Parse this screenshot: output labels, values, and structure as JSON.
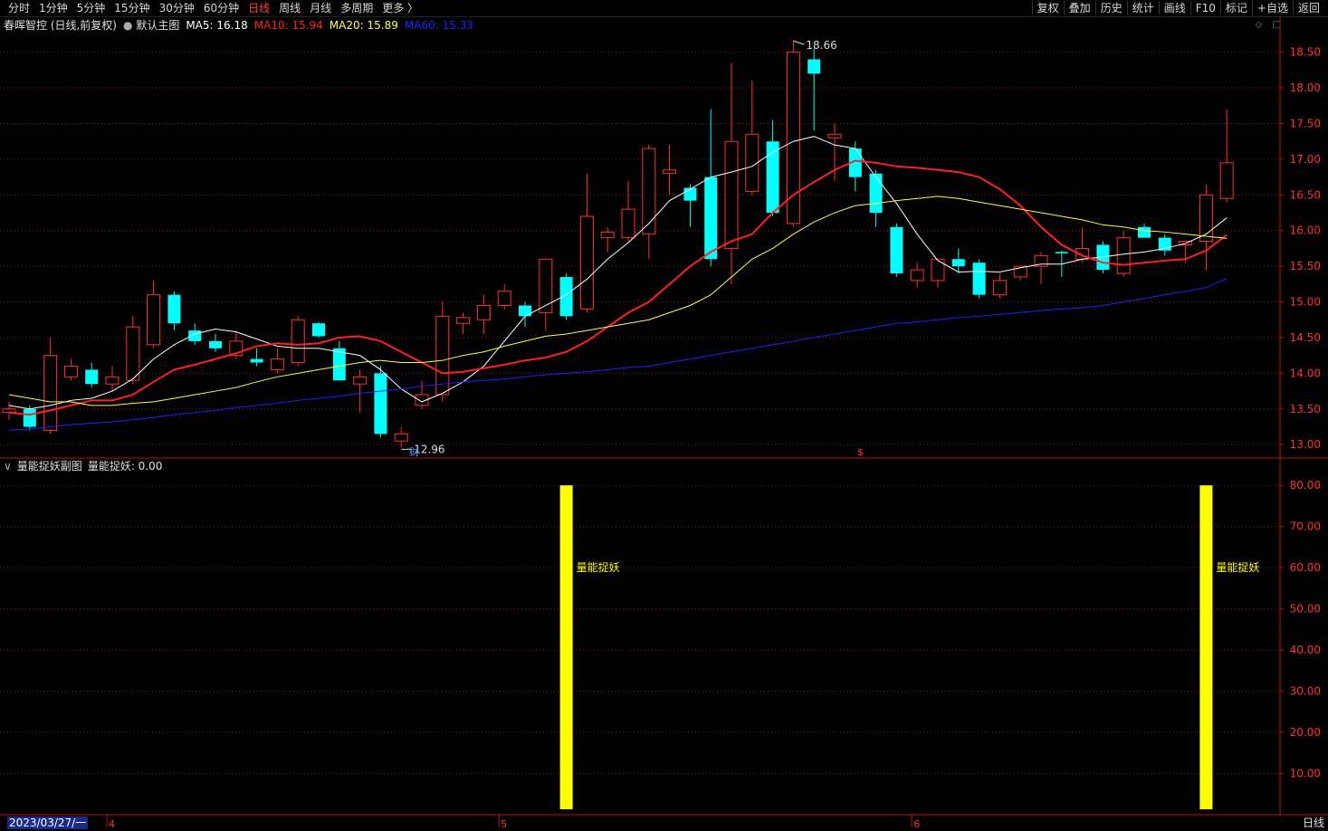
{
  "toolbar": {
    "left_items": [
      "分时",
      "1分钟",
      "5分钟",
      "15分钟",
      "30分钟",
      "60分钟",
      "日线",
      "周线",
      "月线",
      "多周期",
      "更多 〉"
    ],
    "active": "日线",
    "right_items": [
      "复权",
      "叠加",
      "历史",
      "统计",
      "画线",
      "F10",
      "标记",
      "+自选",
      "返回"
    ]
  },
  "main_header": {
    "title": "春晖智控 (日线,前复权)",
    "indicator": "默认主图",
    "ma": [
      {
        "label": "MA5: 16.18",
        "color": "#ffffff"
      },
      {
        "label": "MA10: 15.94",
        "color": "#ff2020"
      },
      {
        "label": "MA20: 15.89",
        "color": "#ffff40"
      },
      {
        "label": "MA60: 15.33",
        "color": "#2020ff"
      }
    ]
  },
  "sub_header": {
    "title": "量能捉妖副图",
    "value_label": "量能捉妖: 0.00"
  },
  "footer": {
    "date": "2023/03/27/一",
    "period": "日线"
  },
  "colors": {
    "up": "#ff3030",
    "down": "#00ffff",
    "grid": "#8b1a1a",
    "axis": "#c01010",
    "signal": "#ffff00"
  },
  "chart_data": [
    {
      "type": "candlestick",
      "ylim": [
        12.85,
        18.75
      ],
      "yticks": [
        13.0,
        13.5,
        14.0,
        14.5,
        15.0,
        15.5,
        16.0,
        16.5,
        17.0,
        17.5,
        18.0,
        18.5
      ],
      "high_marker": "18.66",
      "low_marker": "12.96",
      "event_labels": [
        "财",
        "$"
      ],
      "month_labels": [
        "4",
        "5",
        "6"
      ],
      "candles": [
        {
          "o": 13.45,
          "h": 13.6,
          "l": 13.35,
          "c": 13.5
        },
        {
          "o": 13.5,
          "h": 13.55,
          "l": 13.2,
          "c": 13.25
        },
        {
          "o": 13.2,
          "h": 14.5,
          "l": 13.15,
          "c": 14.25
        },
        {
          "o": 13.95,
          "h": 14.2,
          "l": 13.9,
          "c": 14.1
        },
        {
          "o": 14.05,
          "h": 14.15,
          "l": 13.8,
          "c": 13.85
        },
        {
          "o": 13.85,
          "h": 14.1,
          "l": 13.75,
          "c": 13.95
        },
        {
          "o": 13.9,
          "h": 14.8,
          "l": 13.85,
          "c": 14.65
        },
        {
          "o": 14.4,
          "h": 15.3,
          "l": 14.35,
          "c": 15.1
        },
        {
          "o": 15.1,
          "h": 15.15,
          "l": 14.6,
          "c": 14.7
        },
        {
          "o": 14.6,
          "h": 14.7,
          "l": 14.4,
          "c": 14.45
        },
        {
          "o": 14.45,
          "h": 14.55,
          "l": 14.3,
          "c": 14.35
        },
        {
          "o": 14.25,
          "h": 14.6,
          "l": 14.2,
          "c": 14.45
        },
        {
          "o": 14.2,
          "h": 14.35,
          "l": 14.1,
          "c": 14.15
        },
        {
          "o": 14.05,
          "h": 14.35,
          "l": 14.0,
          "c": 14.2
        },
        {
          "o": 14.15,
          "h": 14.8,
          "l": 14.1,
          "c": 14.75
        },
        {
          "o": 14.7,
          "h": 14.72,
          "l": 14.5,
          "c": 14.52
        },
        {
          "o": 14.35,
          "h": 14.45,
          "l": 13.9,
          "c": 13.9
        },
        {
          "o": 13.85,
          "h": 14.05,
          "l": 13.45,
          "c": 13.95
        },
        {
          "o": 14.0,
          "h": 14.1,
          "l": 13.1,
          "c": 13.15
        },
        {
          "o": 13.05,
          "h": 13.25,
          "l": 12.96,
          "c": 13.15
        },
        {
          "o": 13.55,
          "h": 13.9,
          "l": 13.5,
          "c": 13.7
        },
        {
          "o": 13.7,
          "h": 15.0,
          "l": 13.6,
          "c": 14.8
        },
        {
          "o": 14.7,
          "h": 14.85,
          "l": 14.55,
          "c": 14.78
        },
        {
          "o": 14.75,
          "h": 15.1,
          "l": 14.55,
          "c": 14.95
        },
        {
          "o": 14.95,
          "h": 15.25,
          "l": 14.9,
          "c": 15.15
        },
        {
          "o": 14.95,
          "h": 15.0,
          "l": 14.65,
          "c": 14.8
        },
        {
          "o": 14.85,
          "h": 15.6,
          "l": 14.6,
          "c": 15.6
        },
        {
          "o": 15.35,
          "h": 15.4,
          "l": 14.75,
          "c": 14.8
        },
        {
          "o": 14.9,
          "h": 16.8,
          "l": 14.85,
          "c": 16.2
        },
        {
          "o": 15.9,
          "h": 16.05,
          "l": 15.7,
          "c": 15.98
        },
        {
          "o": 15.9,
          "h": 16.7,
          "l": 15.85,
          "c": 16.3
        },
        {
          "o": 15.95,
          "h": 17.2,
          "l": 15.6,
          "c": 17.15
        },
        {
          "o": 16.8,
          "h": 17.2,
          "l": 16.5,
          "c": 16.85
        },
        {
          "o": 16.6,
          "h": 16.65,
          "l": 16.05,
          "c": 16.42
        },
        {
          "o": 16.75,
          "h": 17.7,
          "l": 15.5,
          "c": 15.6
        },
        {
          "o": 15.75,
          "h": 18.35,
          "l": 15.25,
          "c": 17.25
        },
        {
          "o": 16.55,
          "h": 18.1,
          "l": 16.5,
          "c": 17.35
        },
        {
          "o": 17.25,
          "h": 17.55,
          "l": 16.2,
          "c": 16.25
        },
        {
          "o": 16.1,
          "h": 18.66,
          "l": 16.05,
          "c": 18.5
        },
        {
          "o": 18.4,
          "h": 18.55,
          "l": 17.4,
          "c": 18.2
        },
        {
          "o": 17.3,
          "h": 17.5,
          "l": 16.7,
          "c": 17.35
        },
        {
          "o": 17.15,
          "h": 17.25,
          "l": 16.55,
          "c": 16.75
        },
        {
          "o": 16.8,
          "h": 16.85,
          "l": 16.05,
          "c": 16.25
        },
        {
          "o": 16.05,
          "h": 16.1,
          "l": 15.35,
          "c": 15.4
        },
        {
          "o": 15.3,
          "h": 15.55,
          "l": 15.2,
          "c": 15.45
        },
        {
          "o": 15.3,
          "h": 15.55,
          "l": 15.2,
          "c": 15.6
        },
        {
          "o": 15.6,
          "h": 15.75,
          "l": 15.4,
          "c": 15.5
        },
        {
          "o": 15.55,
          "h": 15.6,
          "l": 15.05,
          "c": 15.1
        },
        {
          "o": 15.1,
          "h": 15.4,
          "l": 15.05,
          "c": 15.3
        },
        {
          "o": 15.35,
          "h": 15.5,
          "l": 15.3,
          "c": 15.5
        },
        {
          "o": 15.5,
          "h": 15.7,
          "l": 15.25,
          "c": 15.65
        },
        {
          "o": 15.7,
          "h": 15.72,
          "l": 15.35,
          "c": 15.68
        },
        {
          "o": 15.6,
          "h": 16.05,
          "l": 15.55,
          "c": 15.75
        },
        {
          "o": 15.8,
          "h": 15.85,
          "l": 15.4,
          "c": 15.45
        },
        {
          "o": 15.4,
          "h": 16.0,
          "l": 15.35,
          "c": 15.9
        },
        {
          "o": 16.05,
          "h": 16.1,
          "l": 15.9,
          "c": 15.9
        },
        {
          "o": 15.9,
          "h": 15.95,
          "l": 15.65,
          "c": 15.72
        },
        {
          "o": 15.8,
          "h": 15.85,
          "l": 15.55,
          "c": 15.85
        },
        {
          "o": 15.85,
          "h": 16.65,
          "l": 15.45,
          "c": 16.5
        },
        {
          "o": 16.45,
          "h": 17.7,
          "l": 16.4,
          "c": 16.95
        }
      ],
      "ma_lines": [
        {
          "name": "MA5",
          "color": "#ffffff",
          "values": [
            13.55,
            13.5,
            13.55,
            13.62,
            13.65,
            13.75,
            13.92,
            14.2,
            14.4,
            14.55,
            14.62,
            14.58,
            14.48,
            14.38,
            14.35,
            14.35,
            14.3,
            14.25,
            14.05,
            13.78,
            13.6,
            13.72,
            13.88,
            14.1,
            14.45,
            14.8,
            14.95,
            15.1,
            15.32,
            15.6,
            15.83,
            16.1,
            16.42,
            16.58,
            16.75,
            16.82,
            16.9,
            17.1,
            17.25,
            17.32,
            17.2,
            17.15,
            16.75,
            16.38,
            15.95,
            15.58,
            15.42,
            15.43,
            15.42,
            15.48,
            15.53,
            15.53,
            15.6,
            15.63,
            15.67,
            15.7,
            15.75,
            15.82,
            15.95,
            16.18
          ]
        },
        {
          "name": "MA10",
          "color": "#ff2020",
          "values": [
            13.45,
            13.42,
            13.48,
            13.55,
            13.62,
            13.62,
            13.7,
            13.88,
            14.05,
            14.12,
            14.2,
            14.28,
            14.38,
            14.42,
            14.4,
            14.42,
            14.5,
            14.52,
            14.45,
            14.3,
            14.15,
            14.0,
            14.02,
            14.07,
            14.12,
            14.18,
            14.22,
            14.3,
            14.45,
            14.65,
            14.85,
            15.0,
            15.25,
            15.5,
            15.7,
            15.85,
            15.95,
            16.25,
            16.5,
            16.68,
            16.85,
            16.98,
            16.95,
            16.9,
            16.88,
            16.85,
            16.82,
            16.75,
            16.58,
            16.35,
            16.05,
            15.8,
            15.65,
            15.55,
            15.52,
            15.55,
            15.58,
            15.6,
            15.72,
            15.94
          ]
        },
        {
          "name": "MA20",
          "color": "#ffff40",
          "values": [
            13.7,
            13.65,
            13.6,
            13.6,
            13.55,
            13.55,
            13.58,
            13.6,
            13.65,
            13.7,
            13.75,
            13.8,
            13.88,
            13.95,
            14.0,
            14.05,
            14.1,
            14.15,
            14.18,
            14.15,
            14.15,
            14.18,
            14.25,
            14.3,
            14.38,
            14.45,
            14.52,
            14.55,
            14.6,
            14.65,
            14.7,
            14.75,
            14.85,
            14.95,
            15.1,
            15.35,
            15.6,
            15.75,
            15.95,
            16.12,
            16.25,
            16.35,
            16.38,
            16.42,
            16.45,
            16.48,
            16.45,
            16.4,
            16.35,
            16.3,
            16.25,
            16.2,
            16.15,
            16.08,
            16.05,
            16.0,
            15.98,
            15.95,
            15.92,
            15.89
          ]
        },
        {
          "name": "MA60",
          "color": "#2020ff",
          "values": [
            13.2,
            13.22,
            13.25,
            13.28,
            13.3,
            13.32,
            13.35,
            13.38,
            13.42,
            13.45,
            13.48,
            13.52,
            13.55,
            13.58,
            13.62,
            13.65,
            13.68,
            13.72,
            13.75,
            13.78,
            13.82,
            13.85,
            13.88,
            13.9,
            13.92,
            13.95,
            13.98,
            14.0,
            14.02,
            14.05,
            14.08,
            14.1,
            14.15,
            14.2,
            14.25,
            14.3,
            14.35,
            14.4,
            14.45,
            14.5,
            14.55,
            14.6,
            14.65,
            14.7,
            14.72,
            14.75,
            14.78,
            14.8,
            14.83,
            14.85,
            14.88,
            14.9,
            14.92,
            14.95,
            15.0,
            15.05,
            15.1,
            15.15,
            15.2,
            15.33
          ]
        }
      ]
    },
    {
      "type": "bar",
      "ylim": [
        0,
        84
      ],
      "yticks": [
        10.0,
        20.0,
        30.0,
        40.0,
        50.0,
        60.0,
        70.0,
        80.0
      ],
      "signals": [
        {
          "index": 27,
          "value": 80,
          "label": "量能捉妖"
        },
        {
          "index": 58,
          "value": 80,
          "label": "量能捉妖"
        }
      ]
    }
  ]
}
